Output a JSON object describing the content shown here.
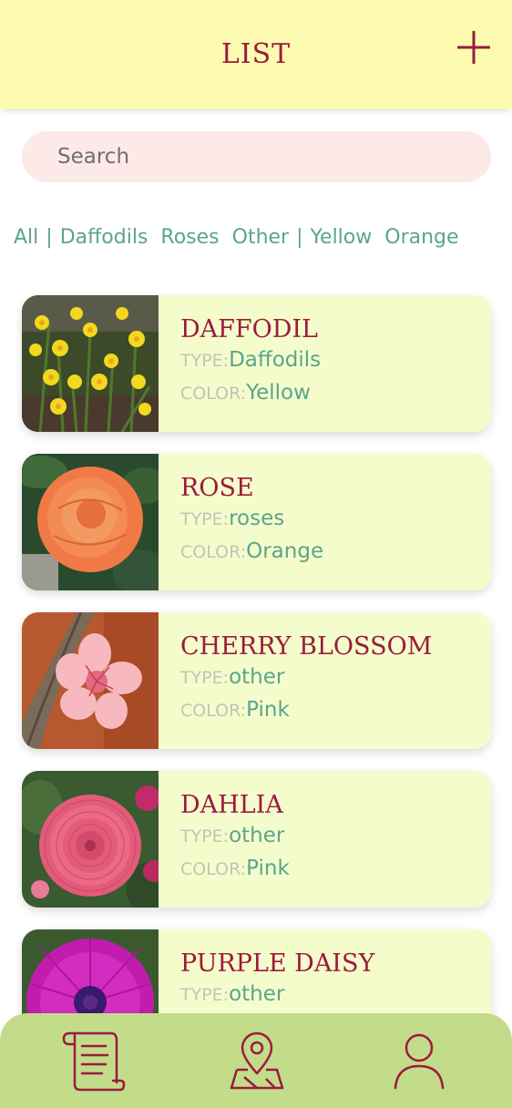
{
  "header": {
    "title": "LIST",
    "add_icon": "plus-icon"
  },
  "search": {
    "placeholder": "Search",
    "value": ""
  },
  "filters": {
    "type_filters": [
      "All",
      "Daffodils",
      "Roses",
      "Other"
    ],
    "color_filters": [
      "Yellow",
      "Orange"
    ],
    "separator": "|"
  },
  "labels": {
    "type": "TYPE:",
    "color": "COLOR:"
  },
  "flowers": [
    {
      "name": "DAFFODIL",
      "type": "Daffodils",
      "color": "Yellow"
    },
    {
      "name": "ROSE",
      "type": "roses",
      "color": "Orange"
    },
    {
      "name": "CHERRY BLOSSOM",
      "type": "other",
      "color": "Pink"
    },
    {
      "name": "DAHLIA",
      "type": "other",
      "color": "Pink"
    },
    {
      "name": "PURPLE DAISY",
      "type": "other",
      "color": ""
    }
  ],
  "bottom_nav": {
    "items": [
      "scroll-list-icon",
      "map-pin-icon",
      "user-profile-icon"
    ]
  },
  "colors": {
    "header_bg": "#fdfbb0",
    "accent": "#9b1b3f",
    "teal": "#5aa58f",
    "card_bg": "#f5fccb",
    "search_bg": "#fce9e8",
    "nav_bg": "#c2dc8a"
  }
}
